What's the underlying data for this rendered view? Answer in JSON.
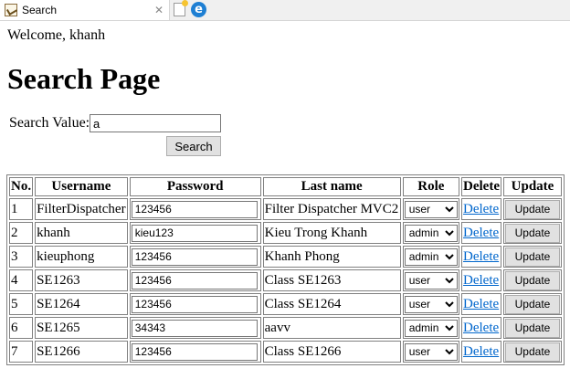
{
  "browser": {
    "tab_title": "Search",
    "close_glyph": "✕"
  },
  "page": {
    "welcome": "Welcome, khanh",
    "title": "Search Page"
  },
  "search": {
    "label": "Search Value:",
    "value": "a",
    "button_label": "Search"
  },
  "table": {
    "headers": {
      "no": "No.",
      "username": "Username",
      "password": "Password",
      "lastname": "Last name",
      "role": "Role",
      "delete": "Delete",
      "update": "Update"
    },
    "delete_label": "Delete",
    "update_label": "Update",
    "rows": [
      {
        "no": "1",
        "username": "FilterDispatcher",
        "password": "123456",
        "lastname": "Filter Dispatcher MVC2",
        "role": "user"
      },
      {
        "no": "2",
        "username": "khanh",
        "password": "kieu123",
        "lastname": "Kieu Trong Khanh",
        "role": "admin"
      },
      {
        "no": "3",
        "username": "kieuphong",
        "password": "123456",
        "lastname": "Khanh Phong",
        "role": "admin"
      },
      {
        "no": "4",
        "username": "SE1263",
        "password": "123456",
        "lastname": "Class SE1263",
        "role": "user"
      },
      {
        "no": "5",
        "username": "SE1264",
        "password": "123456",
        "lastname": "Class SE1264",
        "role": "user"
      },
      {
        "no": "6",
        "username": "SE1265",
        "password": "34343",
        "lastname": "aavv",
        "role": "admin"
      },
      {
        "no": "7",
        "username": "SE1266",
        "password": "123456",
        "lastname": "Class SE1266",
        "role": "user"
      }
    ]
  }
}
